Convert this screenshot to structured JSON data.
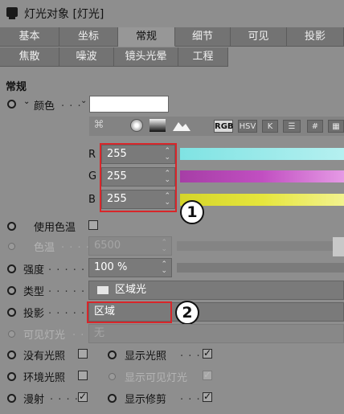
{
  "window": {
    "title": "灯光对象 [灯光]"
  },
  "tabs_row1": [
    "基本",
    "坐标",
    "常规",
    "细节",
    "可见",
    "投影"
  ],
  "tabs_row2": [
    "焦散",
    "噪波",
    "镜头光晕",
    "工程"
  ],
  "section": "常规",
  "color": {
    "label": "颜色",
    "swatch": "#ffffff",
    "rgb_button": "RGB",
    "hsv_button": "HSV",
    "k_button": "K",
    "hash_button": "#",
    "r_label": "R",
    "r_value": "255",
    "g_label": "G",
    "g_value": "255",
    "b_label": "B",
    "b_value": "255",
    "r_bar": "#7fe3e3",
    "g_bar": "#c14fc1",
    "b_bar": "#e6e63c"
  },
  "use_temperature": {
    "label": "使用色温"
  },
  "temperature": {
    "label": "色温",
    "value": "6500"
  },
  "intensity": {
    "label": "强度",
    "value": "100 %"
  },
  "type": {
    "label": "类型",
    "value": "区域光"
  },
  "shadow": {
    "label": "投影",
    "value": "区域"
  },
  "visible_light": {
    "label": "可见灯光",
    "value": "无"
  },
  "options": {
    "no_illumination": "没有光照",
    "ambient": "环境光照",
    "diffuse": "漫射",
    "show_illumination": "显示光照",
    "show_visible_light": "显示可见灯光",
    "show_clipping": "显示修剪"
  },
  "callouts": {
    "one": "1",
    "two": "2"
  },
  "colors": {
    "accent_red": "#d8262a"
  }
}
